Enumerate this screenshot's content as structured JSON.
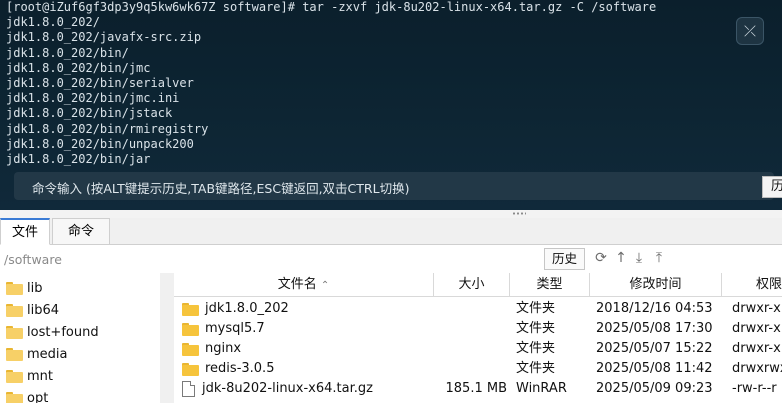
{
  "terminal": {
    "lines": [
      "[root@iZuf6gf3dp3y9q5kw6wk67Z software]# tar -zxvf jdk-8u202-linux-x64.tar.gz -C /software",
      "jdk1.8.0_202/",
      "jdk1.8.0_202/javafx-src.zip",
      "jdk1.8.0_202/bin/",
      "jdk1.8.0_202/bin/jmc",
      "jdk1.8.0_202/bin/serialver",
      "jdk1.8.0_202/bin/jmc.ini",
      "jdk1.8.0_202/bin/jstack",
      "jdk1.8.0_202/bin/rmiregistry",
      "jdk1.8.0_202/bin/unpack200",
      "jdk1.8.0_202/bin/jar"
    ],
    "close_symbol": "⤫",
    "command_bar_hint": "命令输入 (按ALT键提示历史,TAB键路径,ESC键返回,双击CTRL切换)",
    "history_button": "历"
  },
  "tabs": [
    "文件",
    "命令"
  ],
  "path_bar": {
    "path": "/software",
    "history_button": "历史",
    "icons": [
      "refresh-icon",
      "up-arrow-icon",
      "download-icon",
      "upload-icon"
    ]
  },
  "tree": [
    "lib",
    "lib64",
    "lost+found",
    "media",
    "mnt",
    "opt"
  ],
  "file_table": {
    "headers": {
      "name": "文件名",
      "size": "大小",
      "type": "类型",
      "mtime": "修改时间",
      "perm": "权限"
    },
    "rows": [
      {
        "name": "jdk1.8.0_202",
        "size": "",
        "type": "文件夹",
        "mtime": "2018/12/16 04:53",
        "perm": "drwxr-x",
        "icon": "folder-icon"
      },
      {
        "name": "mysql5.7",
        "size": "",
        "type": "文件夹",
        "mtime": "2025/05/08 17:30",
        "perm": "drwxr-x",
        "icon": "folder-icon"
      },
      {
        "name": "nginx",
        "size": "",
        "type": "文件夹",
        "mtime": "2025/05/07 15:22",
        "perm": "drwxr-x",
        "icon": "folder-icon"
      },
      {
        "name": "redis-3.0.5",
        "size": "",
        "type": "文件夹",
        "mtime": "2025/05/08 11:42",
        "perm": "drwxrwx",
        "icon": "folder-icon"
      },
      {
        "name": "jdk-8u202-linux-x64.tar.gz",
        "size": "185.1 MB",
        "type": "WinRAR",
        "mtime": "2025/05/09 09:23",
        "perm": "-rw-r--r",
        "icon": "file-icon"
      }
    ]
  },
  "colors": {
    "terminal_bg": "#0d2533",
    "folder": "#f6c43c",
    "tab_accent": "#3a7bd5"
  }
}
